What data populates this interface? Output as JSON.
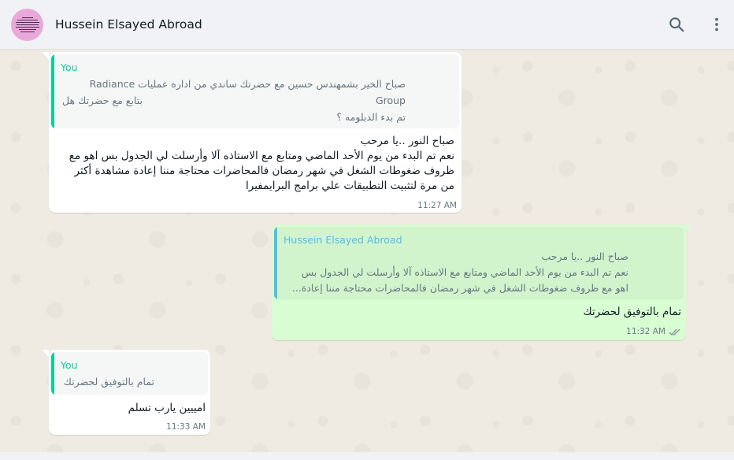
{
  "header": {
    "contact_name": "Hussein Elsayed Abroad",
    "avatar_icon": "profile-picture",
    "search_icon": "search-icon",
    "menu_icon": "kebab-menu-icon"
  },
  "colors": {
    "incoming_bubble": "#ffffff",
    "outgoing_bubble": "#d9fdd3",
    "quote_author_you": "#06cf9c",
    "quote_author_contact": "#53bdeb",
    "read_ticks": "#8696a0"
  },
  "messages": [
    {
      "direction": "incoming",
      "quote": {
        "author": "You",
        "lines": [
          "صباح الخير بشمهندس حسين مع حضرتك ساندي من اداره عمليات Radiance",
          "Group                                                                بتابع مع حضرتك هل",
          "تم بدء الدبلومه ؟"
        ]
      },
      "lines": [
        "صباح النور ..يا مرحب",
        "نعم تم البدء من يوم الأحد الماضي ومتابع مع الاستاذه آلا وأرسلت لي الجدول بس اهو مع",
        "ظروف ضغوطات الشغل في شهر رمضان فالمحاضرات محتاجة مننا إعادة مشاهدة أكثر",
        "من مرة لتثبيت التطبيقات علي برامج البرايمفيرا"
      ],
      "time": "11:27 AM"
    },
    {
      "direction": "outgoing",
      "quote": {
        "author": "Hussein Elsayed Abroad",
        "lines": [
          "صباح النور ..يا مرحب",
          "نعم تم البدء من يوم الأحد الماضي ومتابع مع الاستاذه آلا وأرسلت لي الجدول بس",
          "اهو مع ظروف ضغوطات الشغل في شهر رمضان فالمحاضرات محتاجة مننا إعادة..."
        ]
      },
      "lines": [
        "تمام بالتوفيق لحضرتك"
      ],
      "time": "11:32 AM",
      "status": "read"
    },
    {
      "direction": "incoming",
      "quote": {
        "author": "You",
        "lines": [
          "تمام بالتوفيق لحضرتك"
        ]
      },
      "lines": [
        "امييين يارب تسلم"
      ],
      "time": "11:33 AM"
    }
  ]
}
